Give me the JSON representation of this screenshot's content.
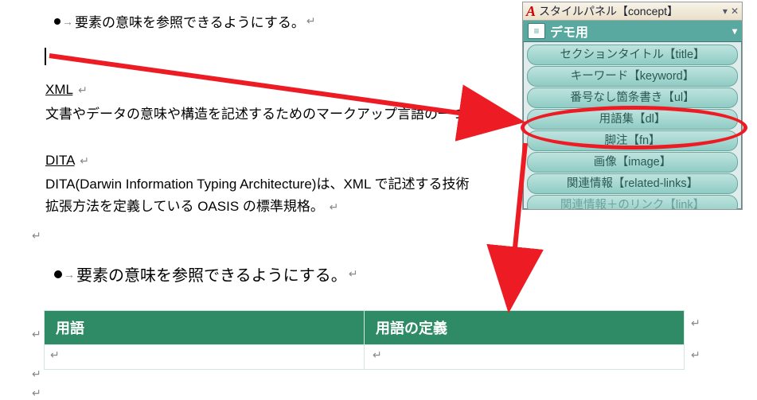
{
  "bullet1_text": "要素の意味を参照できるようにする。",
  "bullet2_text": "要素の意味を参照できるようにする。",
  "tab_arrow": "→",
  "para_return": "↵",
  "defs": {
    "xml": {
      "term": "XML",
      "def": "文書やデータの意味や構造を記述するためのマークアップ言語の一つ。"
    },
    "dita": {
      "term": "DITA",
      "def_line1": "DITA(Darwin Information Typing Architecture)は、XML で記述する技術",
      "def_line2": "拡張方法を定義している OASIS の標準規格。"
    }
  },
  "panel": {
    "title": "スタイルパネル【concept】",
    "subhead": "デモ用",
    "items": [
      "セクションタイトル【title】",
      "キーワード【keyword】",
      "番号なし箇条書き【ul】",
      "用語集【dl】",
      "脚注【fn】",
      "画像【image】",
      "関連情報【related-links】",
      "関連情報＋のリンク【link】"
    ],
    "highlight_index": 3
  },
  "table": {
    "head_term": "用語",
    "head_def": "用語の定義"
  }
}
